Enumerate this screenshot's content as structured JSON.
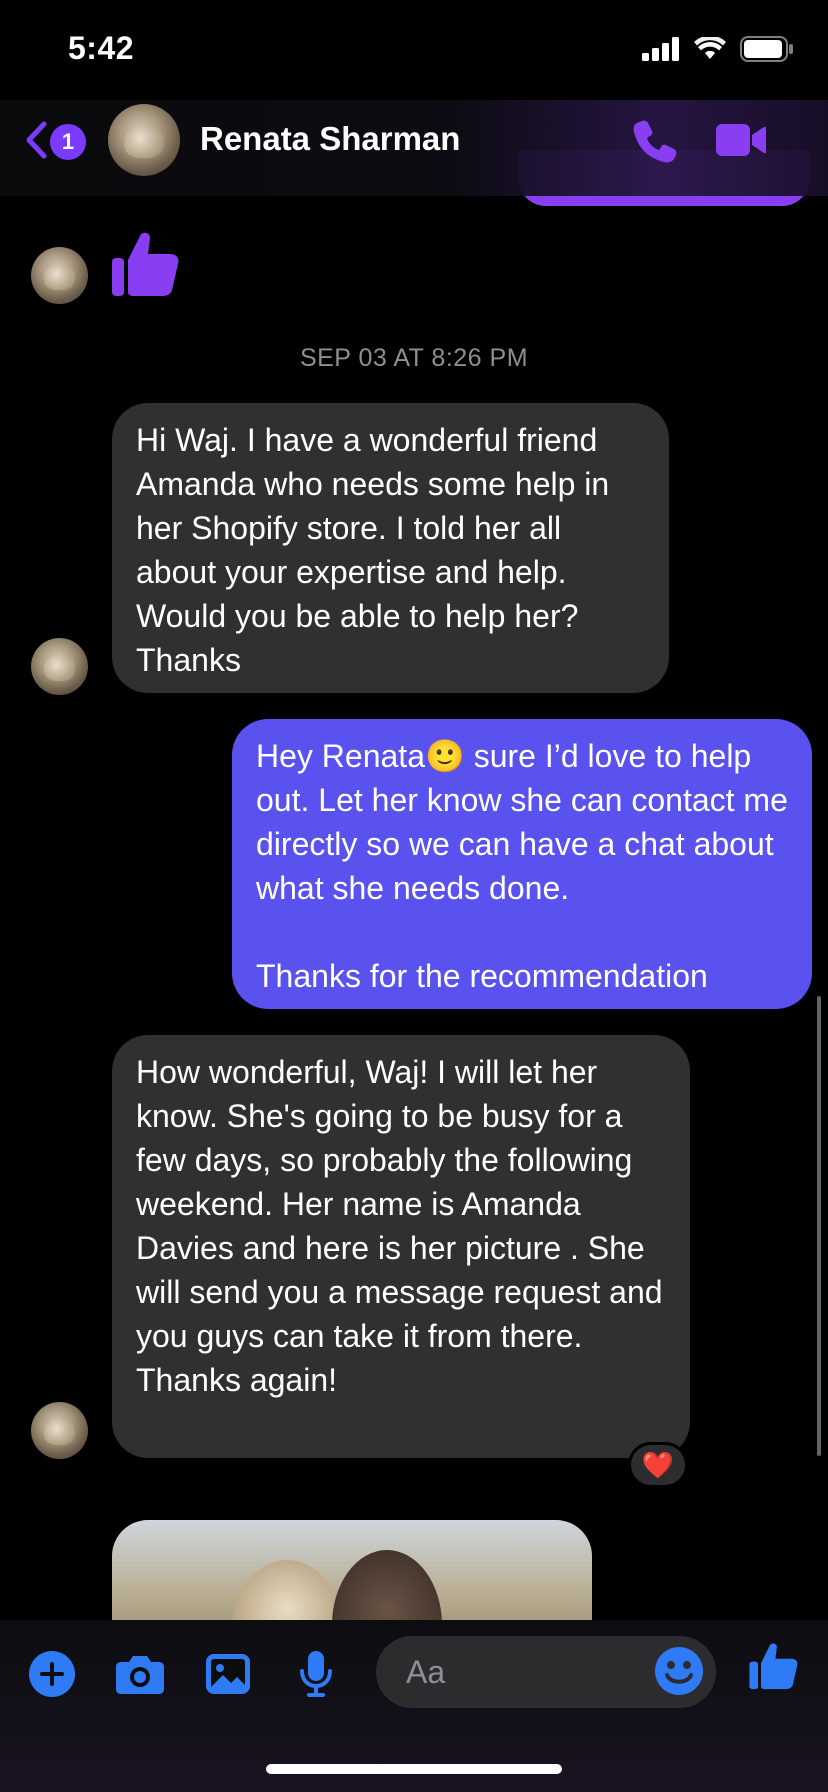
{
  "status": {
    "time": "5:42"
  },
  "header": {
    "back_badge": "1",
    "contact_name": "Renata Sharman"
  },
  "chat": {
    "timestamp": "SEP 03 AT 8:26 PM",
    "messages": [
      {
        "direction": "received",
        "text": "Hi Waj. I have a wonderful friend Amanda who needs some help in her Shopify store. I told her all about your expertise and help. Would you be able to help her? Thanks"
      },
      {
        "direction": "sent",
        "text": "Hey Renata🙂 sure I’d love to help out. Let her know she can contact me directly so we can have a chat about what she needs done.\n\nThanks for the recommendation"
      },
      {
        "direction": "received",
        "text": "How wonderful, Waj! I will let her know. She's going to be busy for a few days, so probably the following weekend. Her name is Amanda Davies and here is her picture . She will send you a message request and you guys can take it from there. Thanks again!",
        "reaction": "❤️"
      }
    ]
  },
  "composer": {
    "placeholder": "Aa"
  },
  "colors": {
    "accent": "#7b3bff",
    "sent_bubble": "#5a52ef",
    "received_bubble": "#303030",
    "composer_icons": "#2f7bf6"
  },
  "icons": [
    "back-chevron-icon",
    "phone-icon",
    "video-camera-icon",
    "thumbs-up-icon",
    "plus-icon",
    "camera-icon",
    "gallery-icon",
    "microphone-icon",
    "emoji-icon"
  ]
}
